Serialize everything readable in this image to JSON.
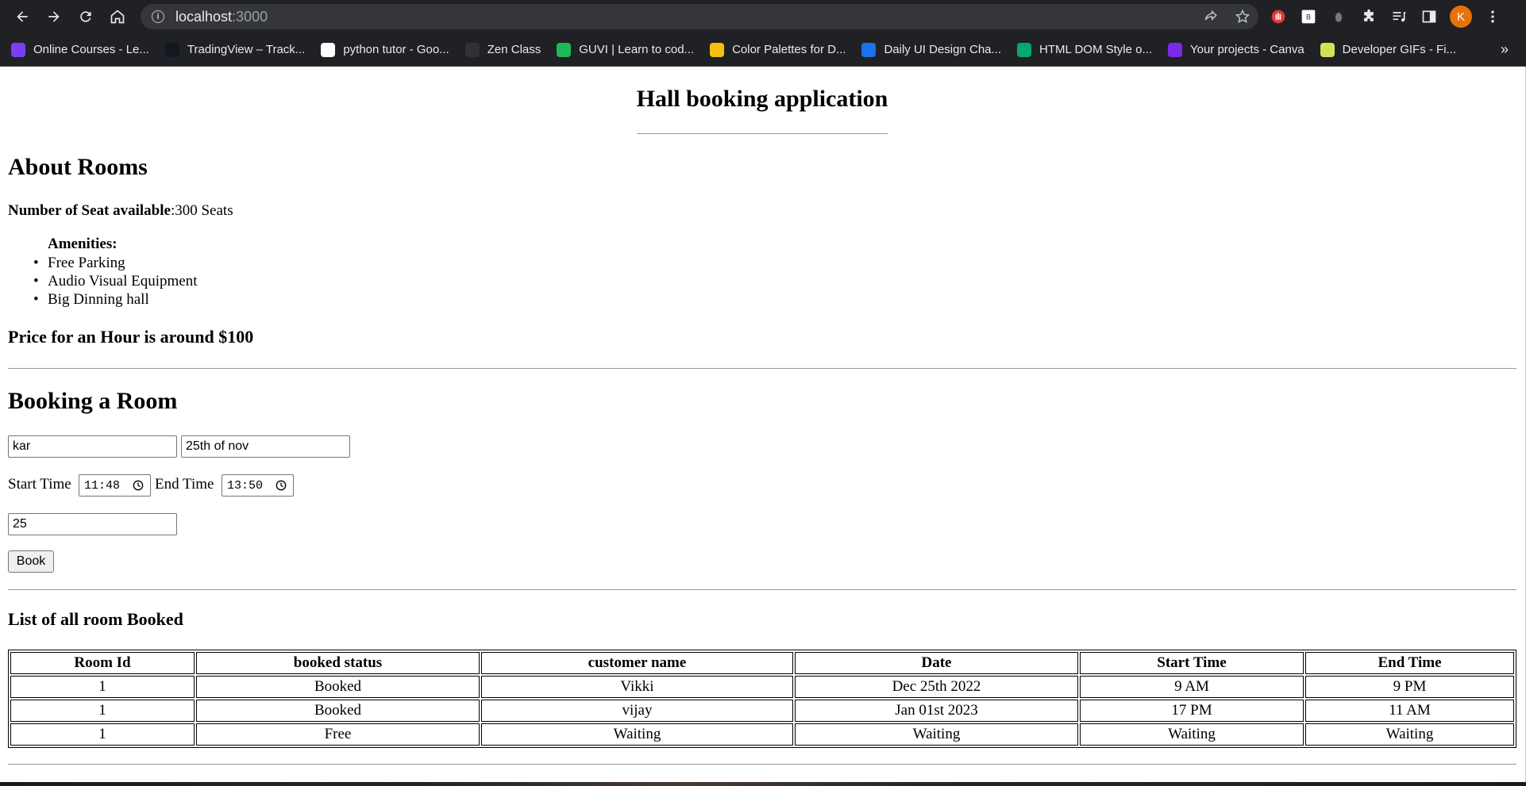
{
  "browser": {
    "url_host": "localhost",
    "url_port": ":3000",
    "avatar_letter": "K",
    "bookmarks": [
      {
        "label": "Online Courses - Le...",
        "icon": "online-courses-icon",
        "color": "#7b3ff2"
      },
      {
        "label": "TradingView – Track...",
        "icon": "tradingview-icon",
        "color": "#131722"
      },
      {
        "label": "python tutor - Goo...",
        "icon": "google-icon",
        "color": "#ffffff"
      },
      {
        "label": "Zen Class",
        "icon": "zen-class-icon",
        "color": "#303134"
      },
      {
        "label": "GUVI | Learn to cod...",
        "icon": "guvi-icon",
        "color": "#1db954"
      },
      {
        "label": "Color Palettes for D...",
        "icon": "color-palettes-icon",
        "color": "#f4c20d"
      },
      {
        "label": "Daily UI Design Cha...",
        "icon": "daily-ui-icon",
        "color": "#1a73e8"
      },
      {
        "label": "HTML DOM Style o...",
        "icon": "w3schools-icon",
        "color": "#04aa6d"
      },
      {
        "label": "Your projects - Canva",
        "icon": "canva-icon",
        "color": "#7d2ae8"
      },
      {
        "label": "Developer GIFs - Fi...",
        "icon": "file-icon",
        "color": "#d4e157"
      }
    ],
    "more_bookmarks": "»"
  },
  "page": {
    "title": "Hall booking application",
    "about_heading": "About Rooms",
    "seat_label": "Number of Seat available",
    "seat_value": ":300 Seats",
    "amenities_label": "Amenities:",
    "amenities": [
      "Free Parking",
      "Audio Visual Equipment",
      "Big Dinning hall"
    ],
    "price_text": "Price for an Hour is around $100",
    "booking_heading": "Booking a Room",
    "form": {
      "name_value": "kar",
      "date_value": "25th of nov",
      "start_label": "Start Time",
      "start_value": "11:48",
      "end_label": "End Time",
      "end_value": "13:50",
      "room_value": "25",
      "book_label": "Book"
    },
    "list_heading": "List of all room Booked",
    "table": {
      "headers": [
        "Room Id",
        "booked status",
        "customer name",
        "Date",
        "Start Time",
        "End Time"
      ],
      "rows": [
        [
          "1",
          "Booked",
          "Vikki",
          "Dec 25th 2022",
          "9 AM",
          "9 PM"
        ],
        [
          "1",
          "Booked",
          "vijay",
          "Jan 01st 2023",
          "17 PM",
          "11 AM"
        ],
        [
          "1",
          "Free",
          "Waiting",
          "Waiting",
          "Waiting",
          "Waiting"
        ]
      ]
    }
  }
}
